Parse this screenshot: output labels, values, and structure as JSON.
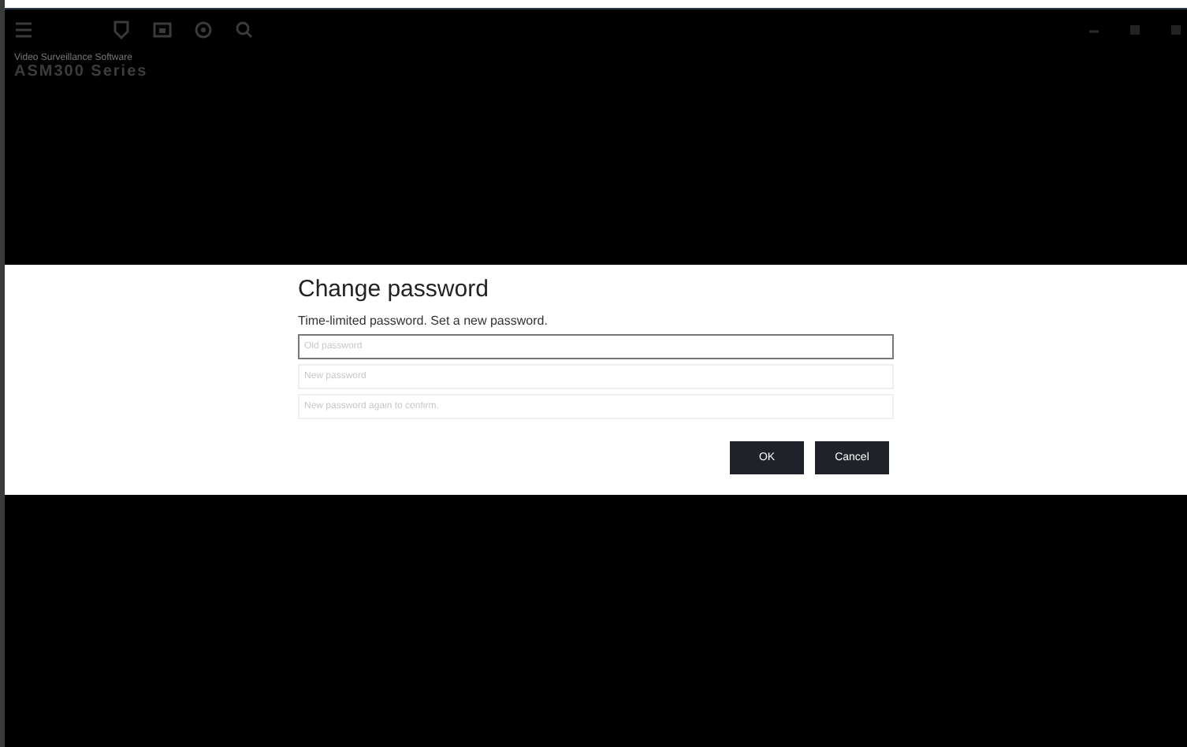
{
  "header": {
    "subtitle": "Video Surveillance Software",
    "title": "ASM300 Series"
  },
  "dialog": {
    "title": "Change password",
    "message": "Time-limited password. Set a new password.",
    "fields": [
      {
        "placeholder": "Old password",
        "focused": true
      },
      {
        "placeholder": "New password",
        "focused": false
      },
      {
        "placeholder": "New password again to confirm.",
        "focused": false
      }
    ],
    "buttons": [
      "OK",
      "Cancel"
    ]
  }
}
